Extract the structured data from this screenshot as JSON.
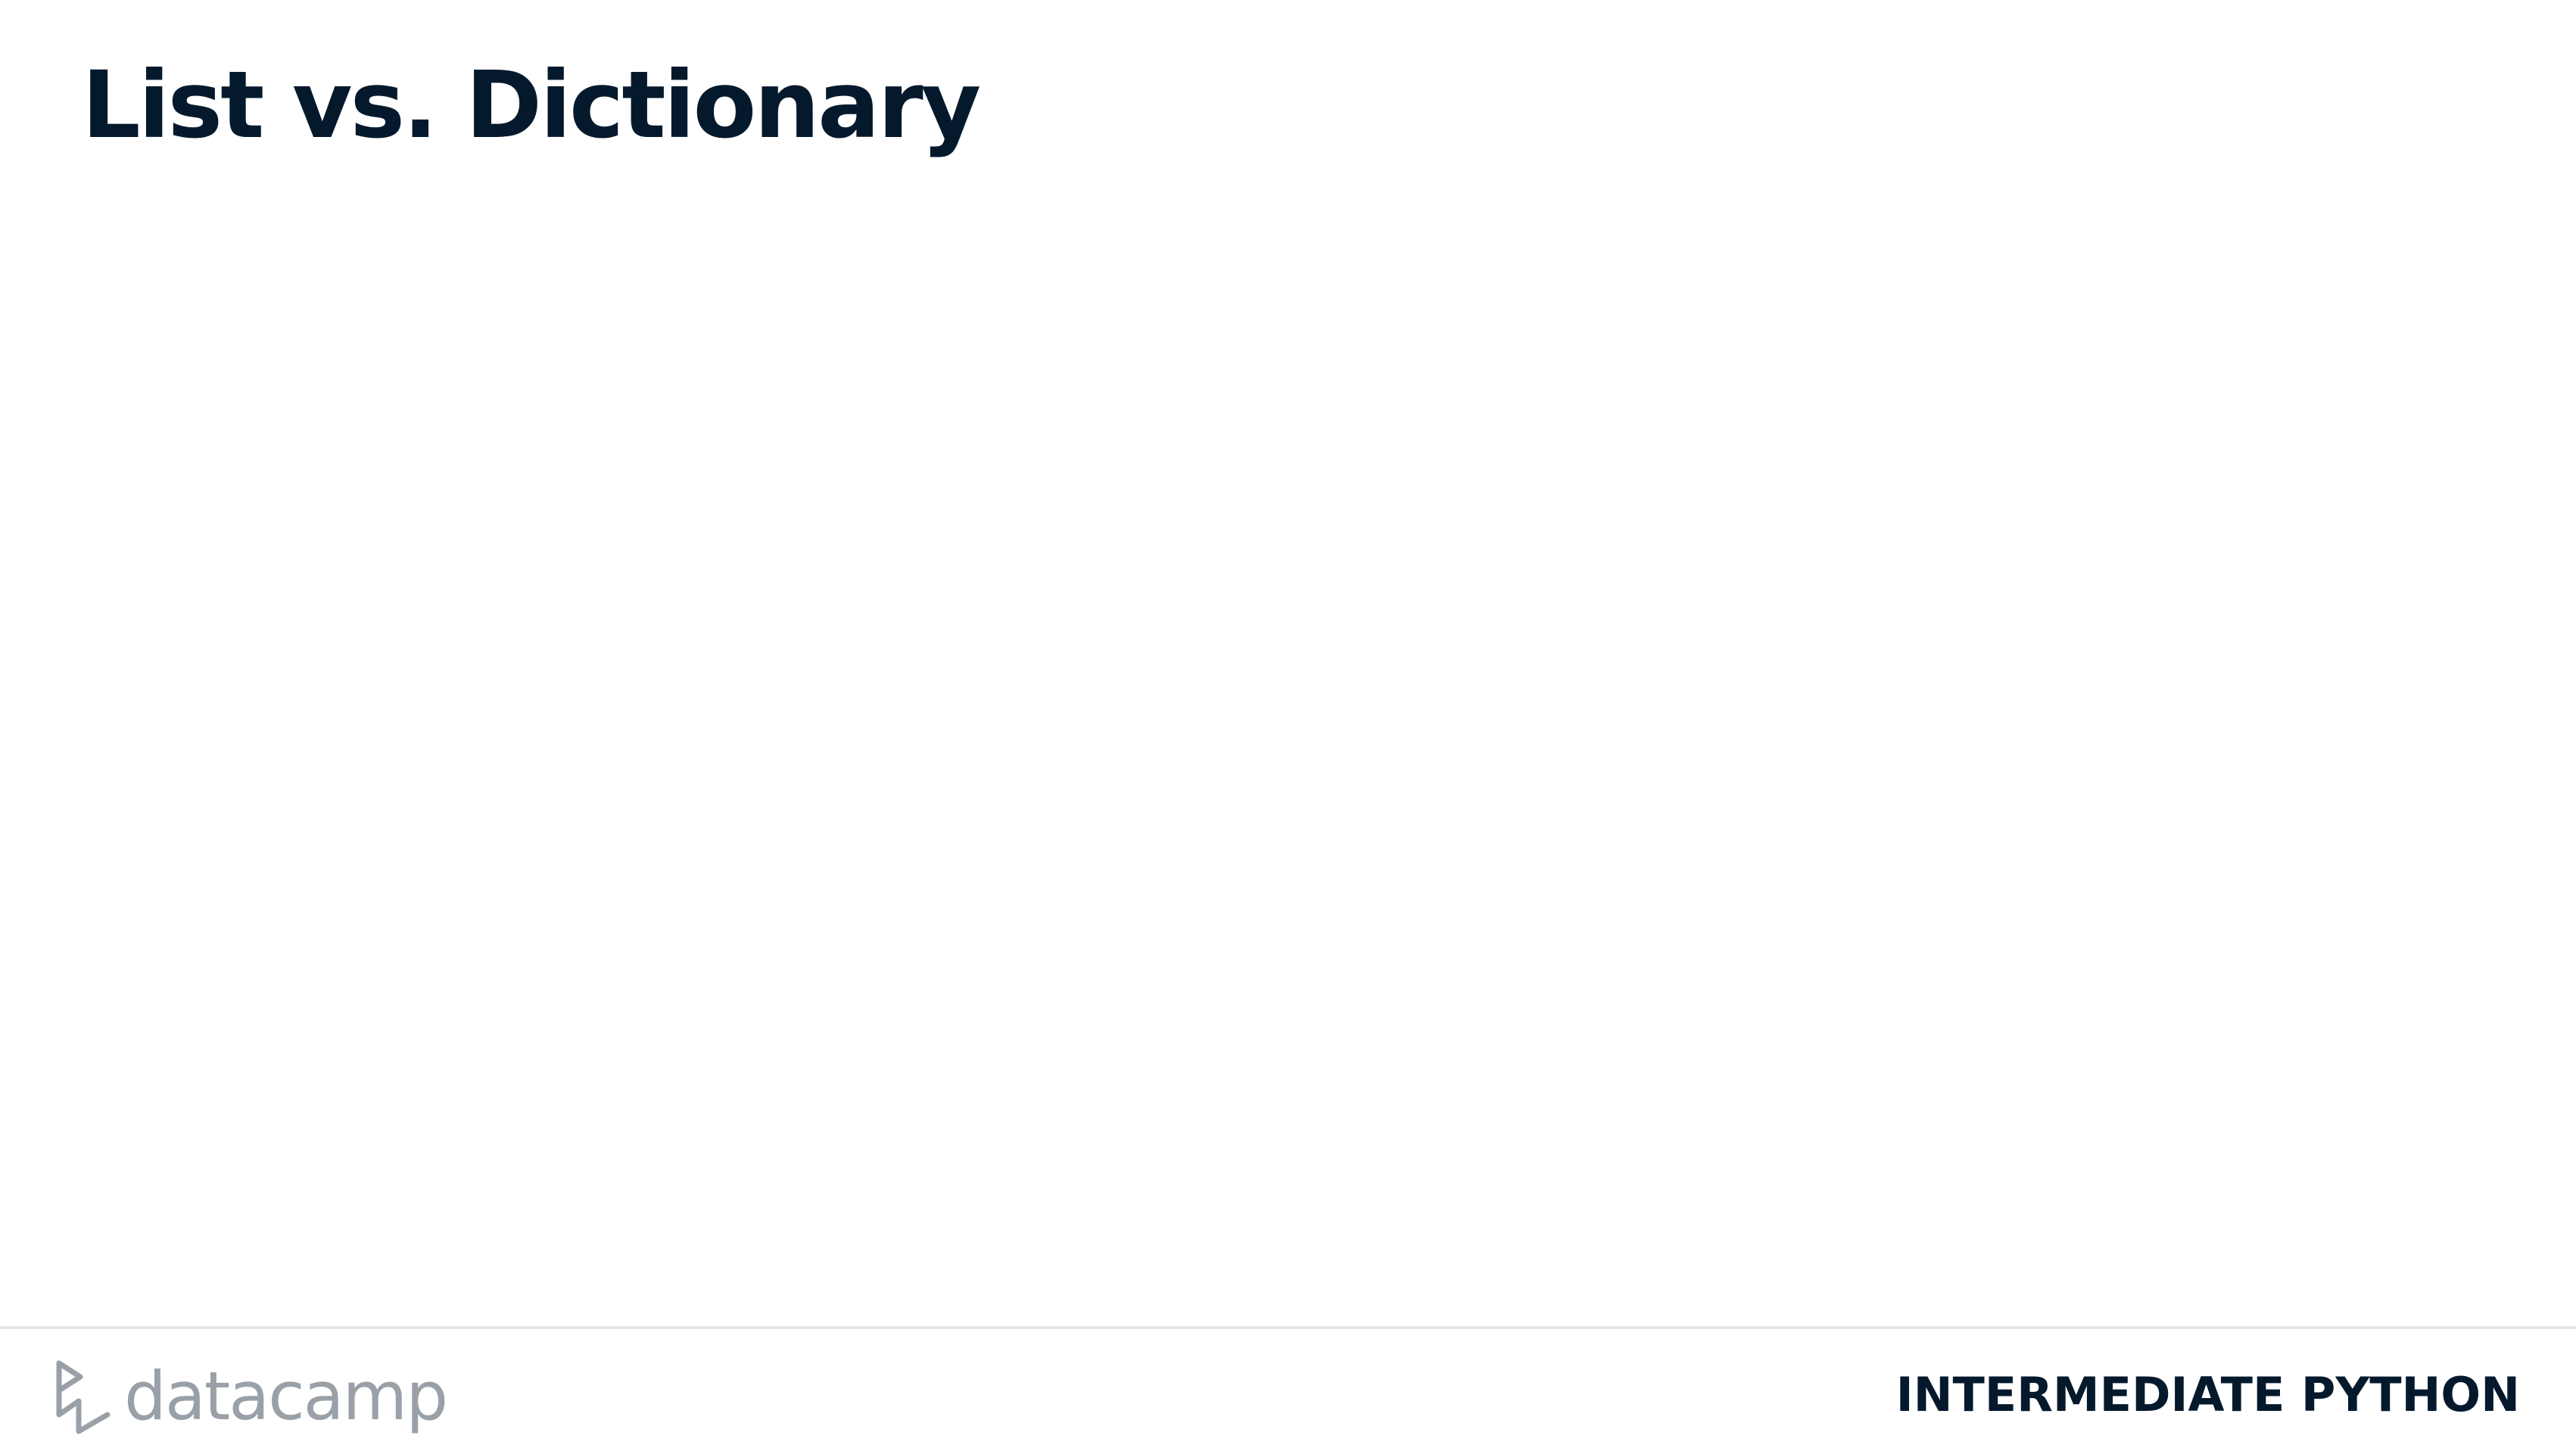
{
  "slide": {
    "title": "List vs. Dictionary"
  },
  "footer": {
    "logo_text": "datacamp",
    "logo_icon": "datacamp-logo-icon",
    "course_name": "INTERMEDIATE PYTHON"
  },
  "colors": {
    "title": "#05192d",
    "logo": "#9aa0a8",
    "divider": "#e5e5e5",
    "background": "#ffffff"
  }
}
